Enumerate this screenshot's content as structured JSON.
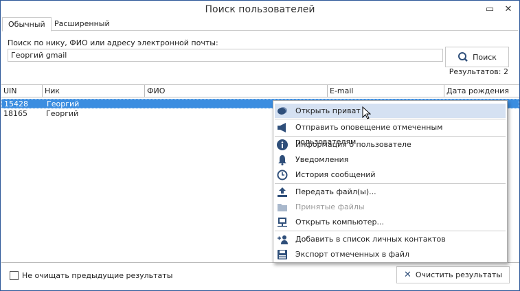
{
  "window": {
    "title": "Поиск пользователей"
  },
  "tabs": [
    {
      "label": "Обычный",
      "active": true
    },
    {
      "label": "Расширенный",
      "active": false
    }
  ],
  "search": {
    "label": "Поиск по нику, ФИО или адресу электронной почты:",
    "value": "Георгий gmail",
    "button": "Поиск"
  },
  "results": "Результатов: 2",
  "table": {
    "columns": [
      "UIN",
      "Ник",
      "ФИО",
      "E-mail",
      "Дата рождения"
    ],
    "rows": [
      {
        "uin": "15428",
        "nick": "Георгий",
        "selected": true
      },
      {
        "uin": "18165",
        "nick": "Георгий",
        "selected": false
      }
    ]
  },
  "context_menu": {
    "items": [
      {
        "label": "Открыть приват",
        "icon": "chat-icon",
        "highlighted": true
      },
      {
        "label": "Отправить оповещение отмеченным пользователям",
        "icon": "megaphone-icon"
      },
      {
        "label": "Информация о пользователе",
        "icon": "info-icon"
      },
      {
        "label": "Уведомления",
        "icon": "bell-icon"
      },
      {
        "label": "История сообщений",
        "icon": "clock-icon"
      },
      {
        "label": "Передать файл(ы)...",
        "icon": "upload-icon"
      },
      {
        "label": "Принятые файлы",
        "icon": "folder-icon",
        "disabled": true
      },
      {
        "label": "Открыть компьютер...",
        "icon": "computer-icon"
      },
      {
        "label": "Добавить в список личных контактов",
        "icon": "add-user-icon"
      },
      {
        "label": "Экспорт отмеченных в файл",
        "icon": "save-icon"
      }
    ]
  },
  "footer": {
    "keep_results_label": "Не очищать предыдущие результаты",
    "keep_results_checked": false,
    "clear_button": "Очистить результаты"
  },
  "colors": {
    "accent": "#2b5797",
    "selection": "#3b8de0",
    "menu_highlight": "#d5e1f2",
    "icon": "#2f4f7a"
  }
}
